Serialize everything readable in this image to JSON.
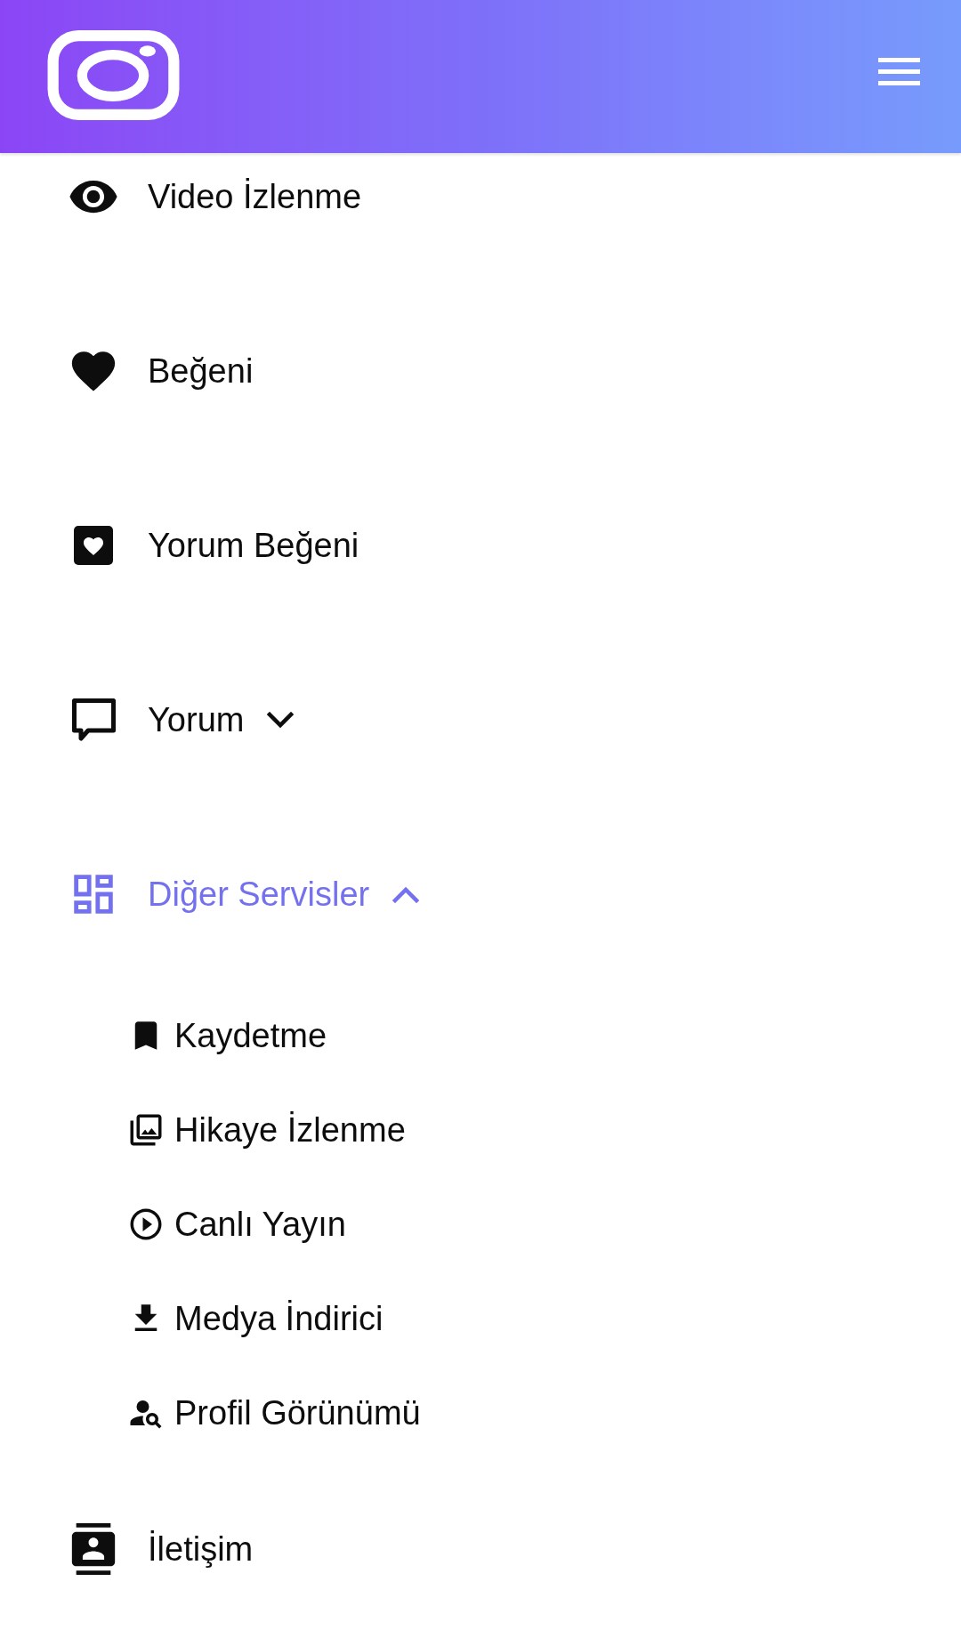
{
  "menu": {
    "items": [
      {
        "label": "Video İzlenme"
      },
      {
        "label": "Beğeni"
      },
      {
        "label": "Yorum Beğeni"
      },
      {
        "label": "Yorum",
        "expanded": false
      },
      {
        "label": "Diğer Servisler",
        "expanded": true,
        "children": [
          {
            "label": "Kaydetme"
          },
          {
            "label": "Hikaye İzlenme"
          },
          {
            "label": "Canlı Yayın"
          },
          {
            "label": "Medya İndirici"
          },
          {
            "label": "Profil Görünümü"
          }
        ]
      },
      {
        "label": "İletişim"
      }
    ]
  }
}
